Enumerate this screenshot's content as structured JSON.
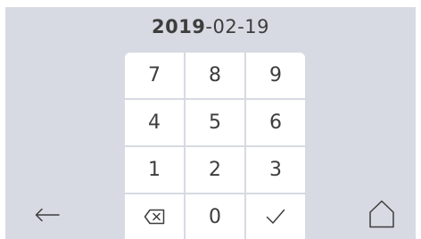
{
  "date": {
    "year": "2019",
    "rest": "-02-19"
  },
  "keypad": {
    "keys": [
      "7",
      "8",
      "9",
      "4",
      "5",
      "6",
      "1",
      "2",
      "3",
      "0"
    ],
    "backspace_icon": "backspace-icon",
    "confirm_icon": "checkmark-icon"
  },
  "nav": {
    "back_icon": "arrow-left-icon",
    "home_icon": "home-icon"
  },
  "colors": {
    "background": "#d7dae2",
    "key": "#ffffff",
    "text": "#3d3d3d"
  }
}
